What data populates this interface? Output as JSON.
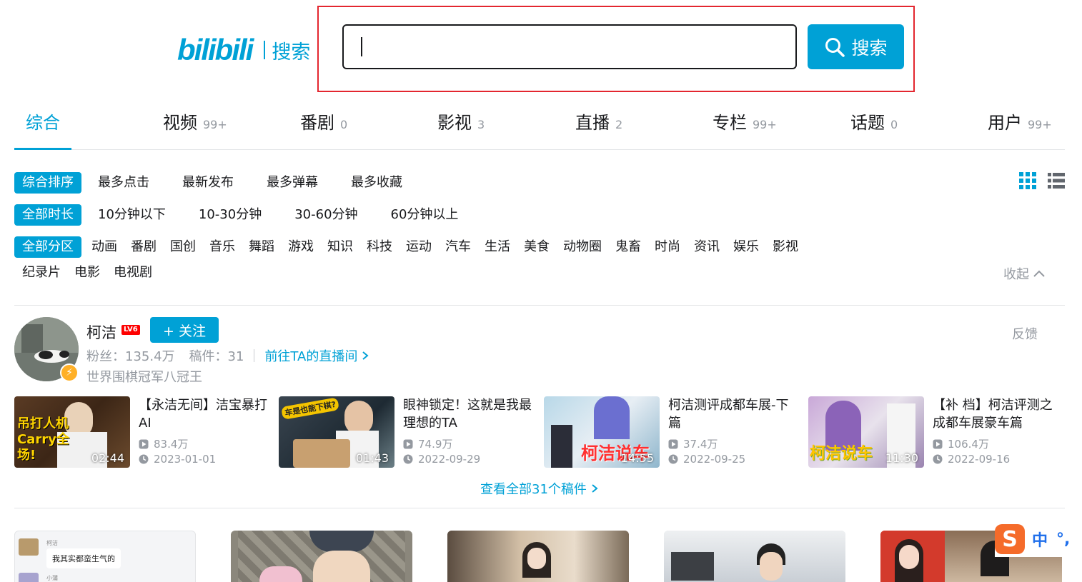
{
  "header": {
    "logo_text": "bilibili",
    "logo_sub": "搜索",
    "search_value": "",
    "search_button": "搜索"
  },
  "tabs": [
    {
      "label": "综合",
      "count": ""
    },
    {
      "label": "视频",
      "count": "99+"
    },
    {
      "label": "番剧",
      "count": "0"
    },
    {
      "label": "影视",
      "count": "3"
    },
    {
      "label": "直播",
      "count": "2"
    },
    {
      "label": "专栏",
      "count": "99+"
    },
    {
      "label": "话题",
      "count": "0"
    },
    {
      "label": "用户",
      "count": "99+"
    }
  ],
  "filters": {
    "sort": [
      "综合排序",
      "最多点击",
      "最新发布",
      "最多弹幕",
      "最多收藏"
    ],
    "duration": [
      "全部时长",
      "10分钟以下",
      "10-30分钟",
      "30-60分钟",
      "60分钟以上"
    ],
    "zones_row1": [
      "全部分区",
      "动画",
      "番剧",
      "国创",
      "音乐",
      "舞蹈",
      "游戏",
      "知识",
      "科技",
      "运动",
      "汽车",
      "生活",
      "美食",
      "动物圈",
      "鬼畜",
      "时尚",
      "资讯",
      "娱乐",
      "影视"
    ],
    "zones_row2": [
      "纪录片",
      "电影",
      "电视剧"
    ],
    "collapse_label": "收起"
  },
  "user": {
    "name": "柯洁",
    "level": "LV6",
    "follow_label": "+ 关注",
    "fans": "粉丝：135.4万",
    "works": "稿件：31",
    "live_link": "前往TA的直播间",
    "desc": "世界围棋冠军八冠王",
    "feedback": "反馈"
  },
  "videos": [
    {
      "title": "【永洁无间】洁宝暴打AI",
      "views": "83.4万",
      "date": "2023-01-01",
      "duration": "02:44",
      "overlay": "吊打人机 Carry全场!"
    },
    {
      "title": "眼神锁定！这就是我最理想的TA",
      "views": "74.9万",
      "date": "2022-09-29",
      "duration": "01:43",
      "overlay": "车是也能下棋?"
    },
    {
      "title": "柯洁测评成都车展-下篇",
      "views": "37.4万",
      "date": "2022-09-25",
      "duration": "14:55",
      "overlay": "柯洁说车"
    },
    {
      "title": "【补 档】柯洁评测之成都车展豪车篇",
      "views": "106.4万",
      "date": "2022-09-16",
      "duration": "11:30",
      "overlay": "柯洁说车"
    }
  ],
  "view_all": "查看全部31个稿件",
  "bottom_card_chat": {
    "name1": "柯洁",
    "bubble": "我其实都蛮生气的",
    "name2": "小蒲"
  },
  "ime": {
    "logo": "S",
    "mode": "中",
    "punct": "°,"
  },
  "colors": {
    "accent": "#00a1d6",
    "highlight": "#e3262f",
    "text": "#18191c",
    "muted": "#9499a0"
  }
}
